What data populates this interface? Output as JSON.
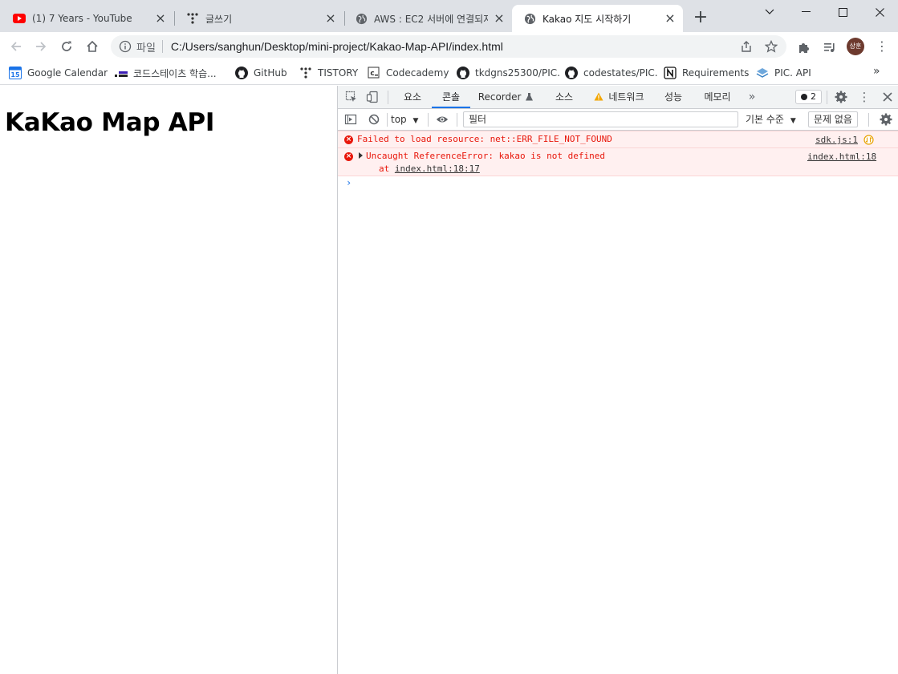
{
  "tabs": [
    {
      "title": "(1) 7 Years - YouTube",
      "icon": "youtube-icon",
      "active": false
    },
    {
      "title": "글쓰기",
      "icon": "tistory-icon",
      "active": false
    },
    {
      "title": "AWS : EC2 서버에 연결되지",
      "icon": "globe-icon",
      "active": false
    },
    {
      "title": "Kakao 지도 시작하기",
      "icon": "globe-icon",
      "active": true
    }
  ],
  "address": {
    "scheme_label": "파일",
    "url": "C:/Users/sanghun/Desktop/mini-project/Kakao-Map-API/index.html"
  },
  "profile": {
    "avatar_text": "상훈",
    "color": "#6d3a2e"
  },
  "bookmarks": [
    {
      "label": "Google Calendar",
      "icon": "calendar-icon"
    },
    {
      "label": "코드스테이츠 학습...",
      "icon": "codestates-icon"
    },
    {
      "label": "GitHub",
      "icon": "github-icon"
    },
    {
      "label": "TISTORY",
      "icon": "tistory-icon"
    },
    {
      "label": "Codecademy",
      "icon": "codecademy-icon"
    },
    {
      "label": "tkdgns25300/PIC.",
      "icon": "github-icon"
    },
    {
      "label": "codestates/PIC.",
      "icon": "github-icon"
    },
    {
      "label": "Requirements",
      "icon": "notion-icon"
    },
    {
      "label": "PIC. API",
      "icon": "layers-icon"
    }
  ],
  "bookmarks_more": "»",
  "page": {
    "heading": "KaKao Map API"
  },
  "devtools": {
    "tabs": [
      "요소",
      "콘솔",
      "Recorder",
      "소스",
      "네트워크",
      "성능",
      "메모리"
    ],
    "active_tab": "콘솔",
    "issues_count": "2",
    "context": "top",
    "filter_placeholder": "필터",
    "levels": "기본 수준",
    "no_issues": "문제 없음",
    "messages": [
      {
        "text": "Failed to load resource: net::ERR_FILE_NOT_FOUND",
        "source": "sdk.js:1"
      },
      {
        "text": "Uncaught ReferenceError: kakao is not defined",
        "source": "index.html:18",
        "stack_prefix": "at ",
        "stack_link": "index.html:18:17"
      }
    ],
    "prompt": "›"
  },
  "colors": {
    "error": "#e8170b",
    "error_bg": "#fff0f0",
    "accent": "#1a73e8"
  }
}
